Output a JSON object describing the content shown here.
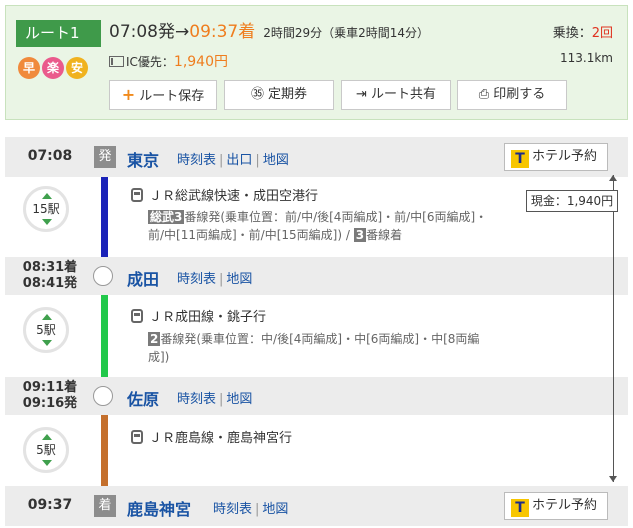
{
  "route": {
    "badge": "ルート1",
    "features": [
      "早",
      "楽",
      "安"
    ],
    "depart_time": "07:08",
    "depart_suffix": "発→",
    "arrive_time": "09:37",
    "arrive_suffix": "着",
    "duration": "2時間29分（乗車2時間14分）",
    "ic_label": "IC優先：",
    "fare": "1,940円",
    "transfer_label": "乗換：",
    "transfer_count": "2回",
    "distance": "113.1km",
    "buttons": {
      "save": "ルート保存",
      "commuter": "定期券",
      "share": "ルート共有",
      "print": "印刷する"
    },
    "button_icons": {
      "save": "+",
      "commuter": "㉟",
      "share": "⇥",
      "print": "⎙"
    }
  },
  "stations": [
    {
      "time": "07:08",
      "mark": "発",
      "name": "東京",
      "links": [
        "時刻表",
        "出口",
        "地図"
      ],
      "hotel": "ホテル予約"
    },
    {
      "time_arr": "08:31着",
      "time_dep": "08:41発",
      "name": "成田",
      "links": [
        "時刻表",
        "地図"
      ]
    },
    {
      "time_arr": "09:11着",
      "time_dep": "09:16発",
      "name": "佐原",
      "links": [
        "時刻表",
        "地図"
      ]
    },
    {
      "time": "09:37",
      "mark": "着",
      "name": "鹿島神宮",
      "links": [
        "時刻表",
        "地図"
      ],
      "hotel": "ホテル予約"
    }
  ],
  "segments": [
    {
      "stops": "15駅",
      "line": "ＪＲ総武線快速・成田空港行",
      "platform_tag": "総武3",
      "detail": "番線発(乗車位置：前/中/後[4両編成]・前/中[6両編成]・前/中[11両編成]・前/中[15両編成]) /",
      "arrival_tag": "3",
      "arrival_text": "番線着"
    },
    {
      "stops": "5駅",
      "line": "ＪＲ成田線・銚子行",
      "platform_tag": "2",
      "detail": "番線発(乗車位置：中/後[4両編成]・中[6両編成]・中[8両編成])"
    },
    {
      "stops": "5駅",
      "line": "ＪＲ鹿島線・鹿島神宮行"
    }
  ],
  "fare_indicator": "現金：1,940円",
  "hotel_logo": "T",
  "colors": {
    "line1": "#1a22b8",
    "line2": "#21c84a",
    "line3": "#c46f2c",
    "accent": "#ef7d1e",
    "badge": "#3f9a4a"
  }
}
